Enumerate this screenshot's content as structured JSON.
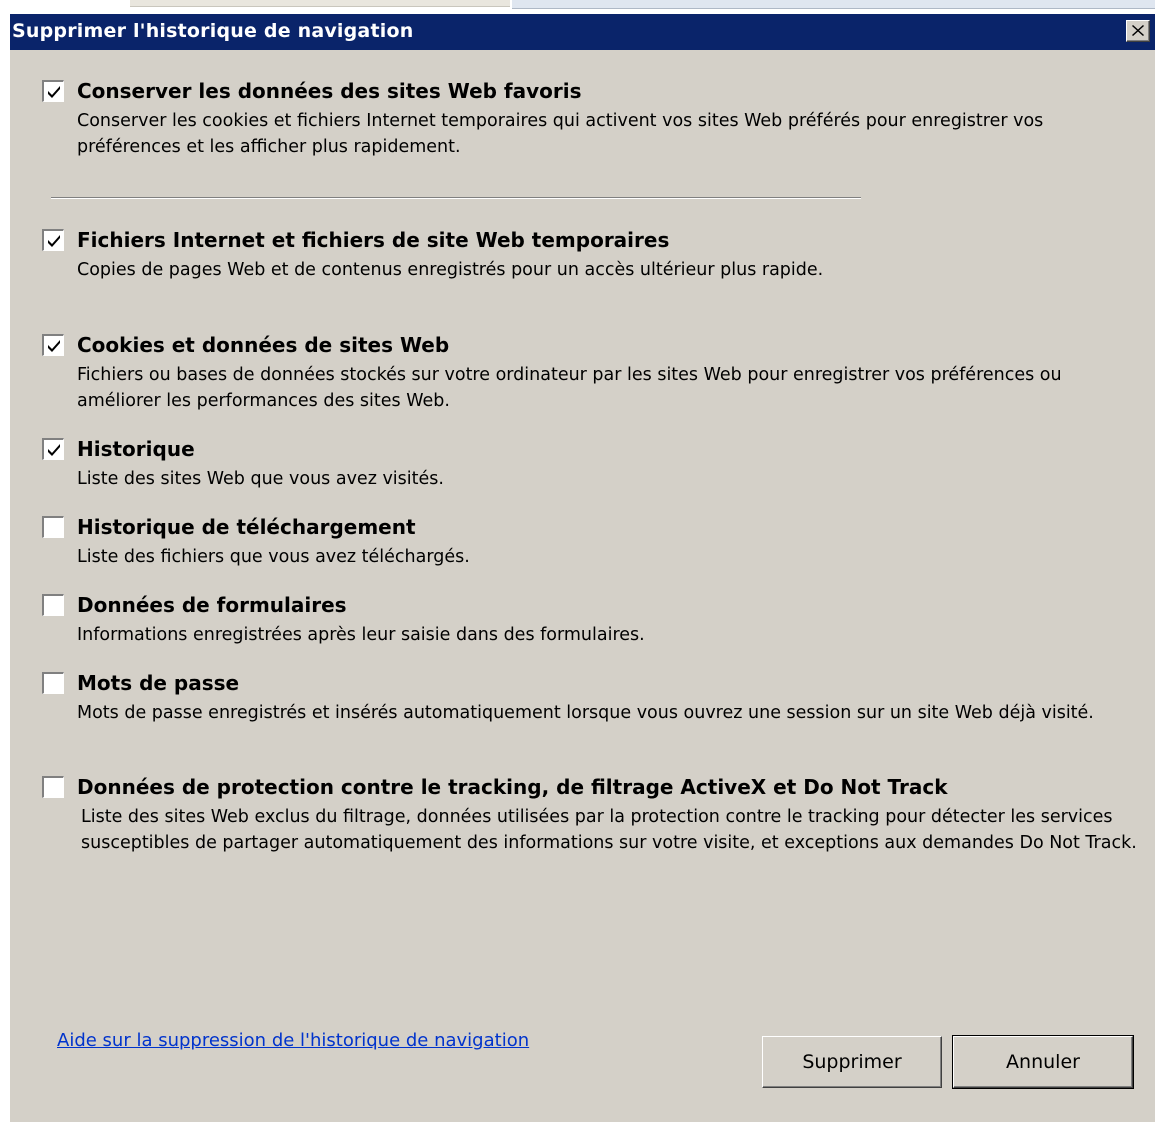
{
  "dialog": {
    "title": "Supprimer l'historique de navigation"
  },
  "options": [
    {
      "title": "Conserver les données des sites Web favoris",
      "description": "Conserver les cookies et fichiers Internet temporaires qui activent vos sites Web préférés pour enregistrer vos préférences et les afficher plus rapidement.",
      "checked": true
    },
    {
      "title": "Fichiers Internet et fichiers de site Web temporaires",
      "description": "Copies de pages Web et de contenus enregistrés pour un accès ultérieur plus rapide.",
      "checked": true
    },
    {
      "title": "Cookies et données de sites Web",
      "description": "Fichiers ou bases de données stockés sur votre ordinateur par les sites Web pour enregistrer vos préférences ou améliorer les performances des sites Web.",
      "checked": true
    },
    {
      "title": "Historique",
      "description": "Liste des sites Web que vous avez visités.",
      "checked": true
    },
    {
      "title": "Historique de téléchargement",
      "description": "Liste des fichiers que vous avez téléchargés.",
      "checked": false
    },
    {
      "title": "Données de formulaires",
      "description": "Informations enregistrées après leur saisie dans des formulaires.",
      "checked": false
    },
    {
      "title": "Mots de passe",
      "description": "Mots de passe enregistrés et insérés automatiquement lorsque vous ouvrez une session sur un site Web déjà visité.",
      "checked": false
    },
    {
      "title": "Données de protection contre le tracking, de filtrage ActiveX et Do Not Track",
      "description": "Liste des sites Web exclus du filtrage, données utilisées par la protection contre le tracking pour détecter les services susceptibles de partager automatiquement des informations sur votre visite, et exceptions aux demandes Do Not Track.",
      "checked": false
    }
  ],
  "footer": {
    "help_link": "Aide sur la suppression de l'historique de navigation",
    "delete_label": "Supprimer",
    "cancel_label": "Annuler"
  },
  "colors": {
    "titlebar": "#0a246a",
    "dialog_bg": "#d4d0c8",
    "link": "#0033cc"
  }
}
